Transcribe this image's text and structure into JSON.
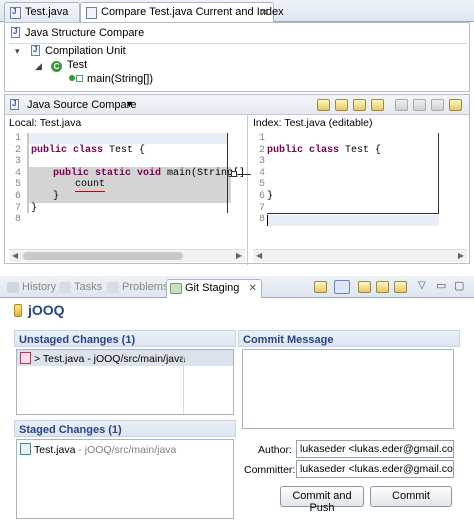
{
  "editor_tabs": [
    {
      "label": "Test.java"
    },
    {
      "label": "Compare Test.java Current and Index"
    }
  ],
  "structure": {
    "title": "Java Structure Compare",
    "nodes": [
      "Compilation Unit",
      "Test",
      "main(String[])"
    ]
  },
  "source_compare": {
    "title": "Java Source Compare",
    "left_label": "Local: Test.java",
    "right_label": "Index: Test.java (editable)",
    "left_lines": [
      "1",
      "2",
      "3",
      "4",
      "5",
      "6",
      "7",
      "8"
    ],
    "right_lines": [
      "1",
      "2",
      "3",
      "4",
      "5",
      "6",
      "7",
      "8"
    ],
    "left_code": {
      "l2_kw": "public class",
      "l2_rest": " Test {",
      "l4_kw": "public static void",
      "l4_rest": " main(String[]",
      "l5": "count",
      "l6": "}",
      "l7": "}"
    },
    "right_code": {
      "l2_kw": "public class",
      "l2_rest": " Test {",
      "l7": "}"
    }
  },
  "view_tabs": [
    {
      "label": "History"
    },
    {
      "label": "Tasks"
    },
    {
      "label": "Problems"
    },
    {
      "label": "Git Staging"
    }
  ],
  "staging": {
    "repo_name": "jOOQ",
    "unstaged_title": "Unstaged Changes (1)",
    "unstaged_items": [
      "> Test.java - jOOQ/src/main/java"
    ],
    "staged_title": "Staged Changes (1)",
    "staged_items": [
      {
        "name": "Test.java",
        "path": " - jOOQ/src/main/java"
      }
    ],
    "commit_title": "Commit Message",
    "author_label": "Author:",
    "author_value": "lukaseder <lukas.eder@gmail.com>",
    "committer_label": "Committer:",
    "committer_value": "lukaseder <lukas.eder@gmail.com>",
    "commit_push_label": "Commit and Push",
    "commit_label": "Commit"
  },
  "colors": {
    "accent": "#26458a",
    "keyword": "#7f0055",
    "diff_bg": "#d4d4d4"
  }
}
